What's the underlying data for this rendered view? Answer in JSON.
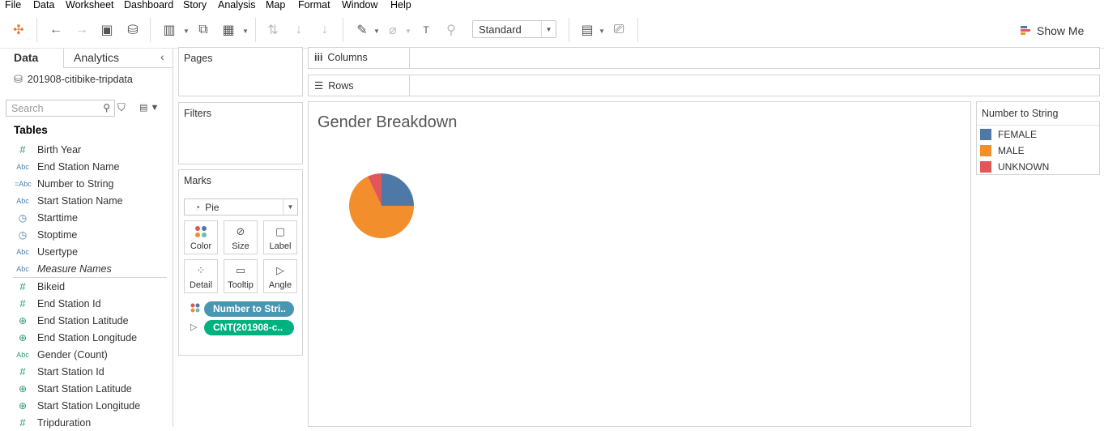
{
  "menu": [
    "File",
    "Data",
    "Worksheet",
    "Dashboard",
    "Story",
    "Analysis",
    "Map",
    "Format",
    "Window",
    "Help"
  ],
  "toolbar": {
    "fit_select": "Standard",
    "show_me_label": "Show Me"
  },
  "left_pane": {
    "tabs": [
      "Data",
      "Analytics"
    ],
    "datasource": "201908-citibike-tripdata",
    "search_placeholder": "Search",
    "tables_heading": "Tables",
    "dimensions": [
      {
        "icon": "#",
        "type": "num",
        "name": "Birth Year"
      },
      {
        "icon": "Abc",
        "type": "abc",
        "name": "End Station Name"
      },
      {
        "icon": "=Abc",
        "type": "abc",
        "name": "Number to String"
      },
      {
        "icon": "Abc",
        "type": "abc",
        "name": "Start Station Name"
      },
      {
        "icon": "date",
        "type": "date",
        "name": "Starttime"
      },
      {
        "icon": "date",
        "type": "date",
        "name": "Stoptime"
      },
      {
        "icon": "Abc",
        "type": "abc",
        "name": "Usertype"
      },
      {
        "icon": "Abc",
        "type": "abc",
        "name": "Measure Names",
        "italic": true
      }
    ],
    "measures": [
      {
        "icon": "#",
        "type": "num",
        "name": "Bikeid"
      },
      {
        "icon": "#",
        "type": "num",
        "name": "End Station Id"
      },
      {
        "icon": "geo",
        "type": "geo",
        "name": "End Station Latitude"
      },
      {
        "icon": "geo",
        "type": "geo",
        "name": "End Station Longitude"
      },
      {
        "icon": "Abc",
        "type": "abcg",
        "name": "Gender (Count)"
      },
      {
        "icon": "#",
        "type": "num",
        "name": "Start Station Id"
      },
      {
        "icon": "geo",
        "type": "geo",
        "name": "Start Station Latitude"
      },
      {
        "icon": "geo",
        "type": "geo",
        "name": "Start Station Longitude"
      },
      {
        "icon": "#",
        "type": "num",
        "name": "Tripduration"
      }
    ]
  },
  "cards": {
    "pages": "Pages",
    "filters": "Filters",
    "marks": "Marks",
    "mark_type": "Pie",
    "mark_buttons": [
      "Color",
      "Size",
      "Label",
      "Detail",
      "Tooltip",
      "Angle"
    ],
    "pills": [
      "Number to Stri..",
      "CNT(201908-c.."
    ]
  },
  "shelves": {
    "columns": "Columns",
    "rows": "Rows"
  },
  "view": {
    "title": "Gender Breakdown"
  },
  "legend": {
    "title": "Number to String",
    "items": [
      {
        "name": "FEMALE",
        "color": "#4e79a7"
      },
      {
        "name": "MALE",
        "color": "#f28e2b"
      },
      {
        "name": "UNKNOWN",
        "color": "#e15759"
      }
    ]
  },
  "chart_data": {
    "type": "pie",
    "title": "Gender Breakdown",
    "categories": [
      "FEMALE",
      "MALE",
      "UNKNOWN"
    ],
    "values": [
      25,
      68,
      7
    ],
    "colors": [
      "#4e79a7",
      "#f28e2b",
      "#e15759"
    ]
  }
}
